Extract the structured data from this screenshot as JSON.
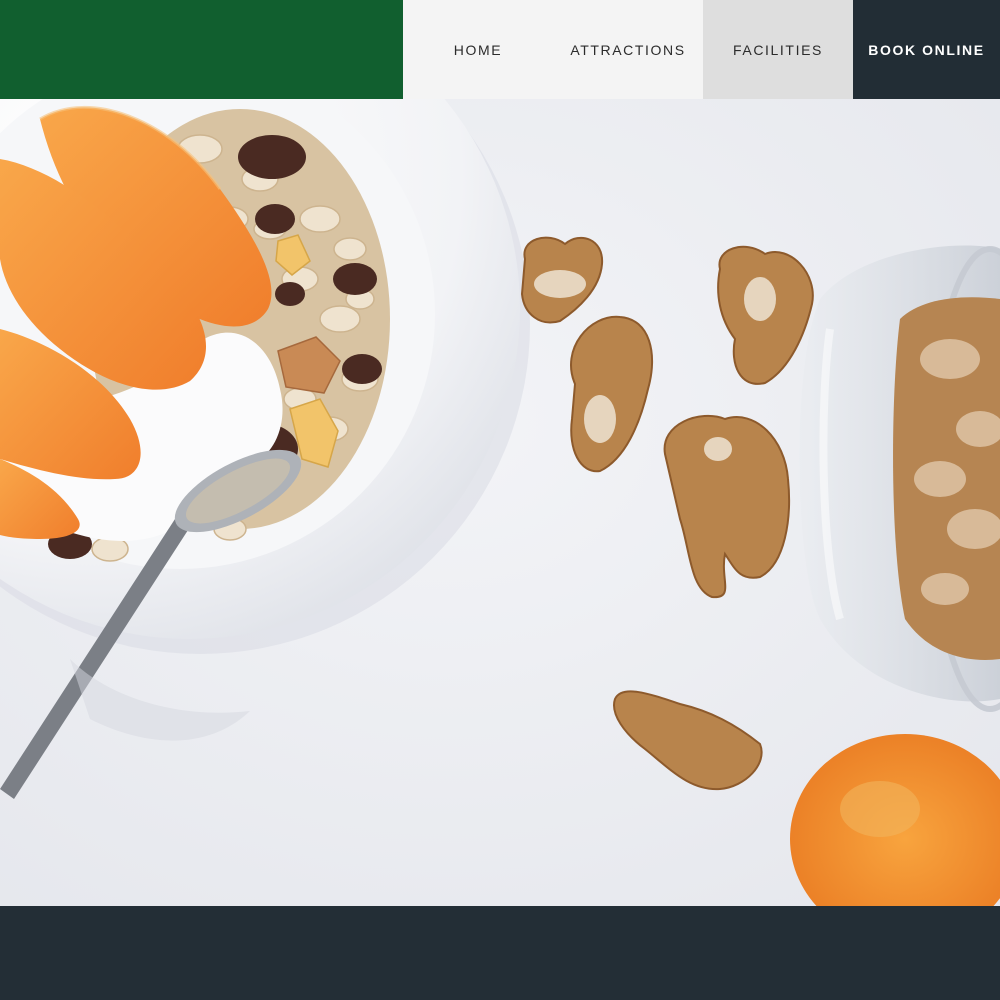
{
  "header": {
    "brand_color": "#115f2f",
    "nav": {
      "home": "HOME",
      "attractions": "ATTRACTIONS",
      "facilities": "FACILITIES",
      "book_online": "BOOK ONLINE"
    },
    "active_item": "FACILITIES"
  },
  "hero": {
    "image_subject": "hero-food-photo"
  },
  "footer": {
    "background": "#232e36"
  }
}
